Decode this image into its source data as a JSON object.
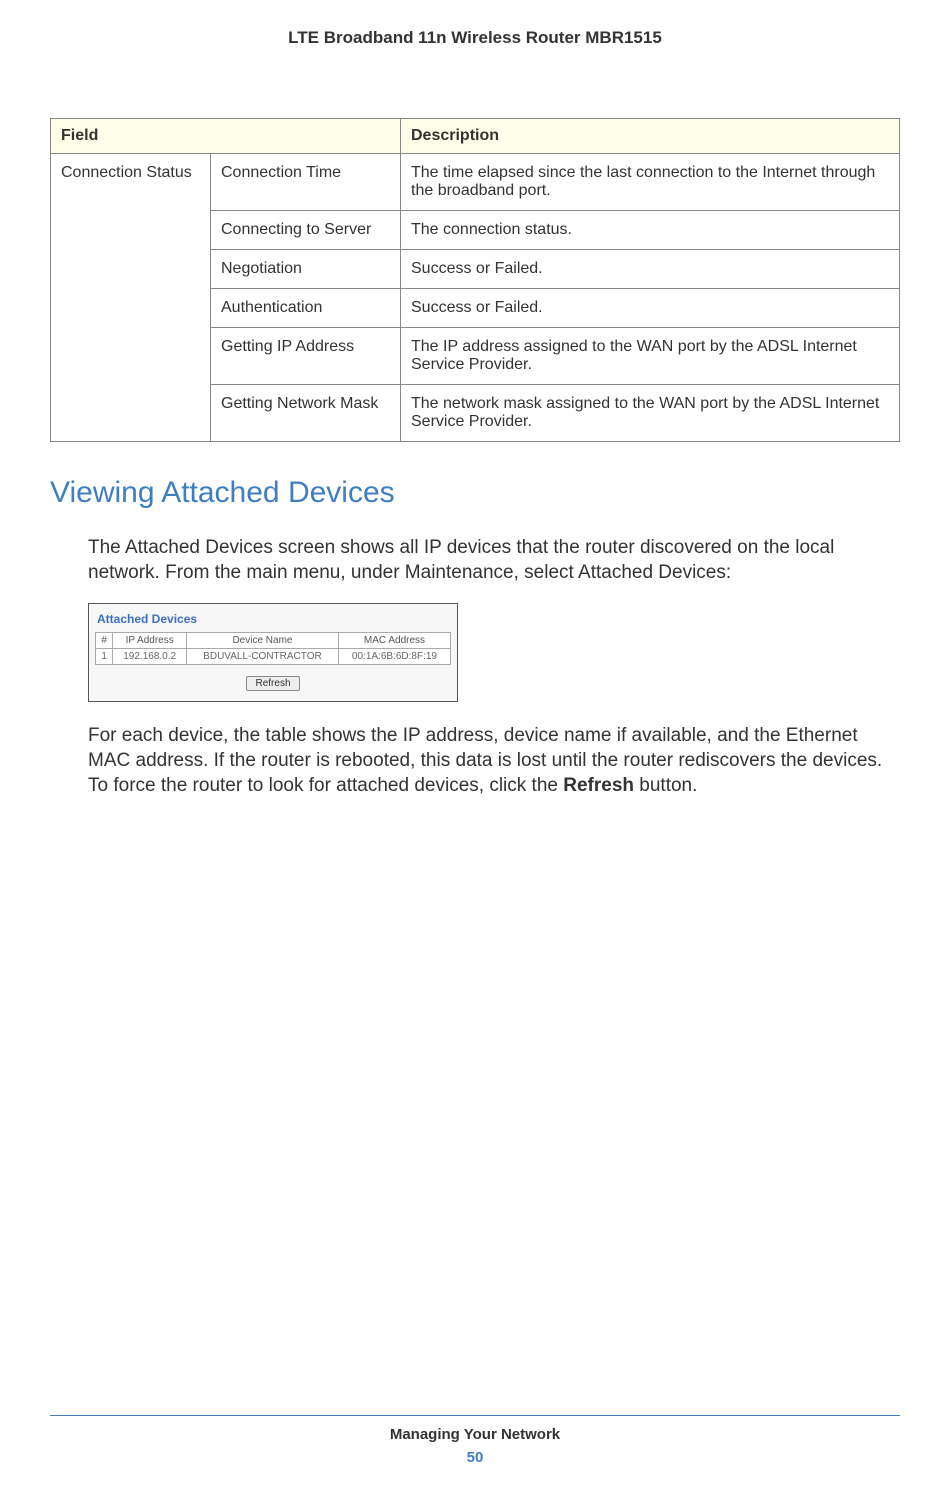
{
  "header": {
    "title": "LTE Broadband 11n Wireless Router MBR1515"
  },
  "table": {
    "col1_header": "Field",
    "col2_header": "Description",
    "group_label": "Connection Status",
    "rows": [
      {
        "field": "Connection Time",
        "desc": "The time elapsed since the last connection to the Internet through the broadband port."
      },
      {
        "field": "Connecting to Server",
        "desc": "The connection status."
      },
      {
        "field": "Negotiation",
        "desc": "Success or Failed."
      },
      {
        "field": "Authentication",
        "desc": "Success or Failed."
      },
      {
        "field": "Getting IP Address",
        "desc": "The IP address assigned to the WAN port by the ADSL Internet Service Provider."
      },
      {
        "field": "Getting Network Mask",
        "desc": "The network mask assigned to the WAN port by the ADSL Internet Service Provider."
      }
    ]
  },
  "section": {
    "heading": "Viewing Attached Devices",
    "para1": "The Attached Devices screen shows all IP devices that the router discovered on the local network. From the main menu, under Maintenance, select Attached Devices:",
    "para2_a": "For each device, the table shows the IP address, device name if available, and the Ethernet MAC address. If the router is rebooted, this data is lost until the router rediscovers the devices. To force the router to look for attached devices, click the ",
    "para2_bold": "Refresh",
    "para2_b": " button."
  },
  "screenshot": {
    "title": "Attached Devices",
    "cols": {
      "num": "#",
      "ip": "IP Address",
      "name": "Device Name",
      "mac": "MAC Address"
    },
    "row": {
      "num": "1",
      "ip": "192.168.0.2",
      "name": "BDUVALL-CONTRACTOR",
      "mac": "00:1A:6B:6D:8F:19"
    },
    "refresh": "Refresh"
  },
  "footer": {
    "text": "Managing Your Network",
    "page": "50"
  }
}
